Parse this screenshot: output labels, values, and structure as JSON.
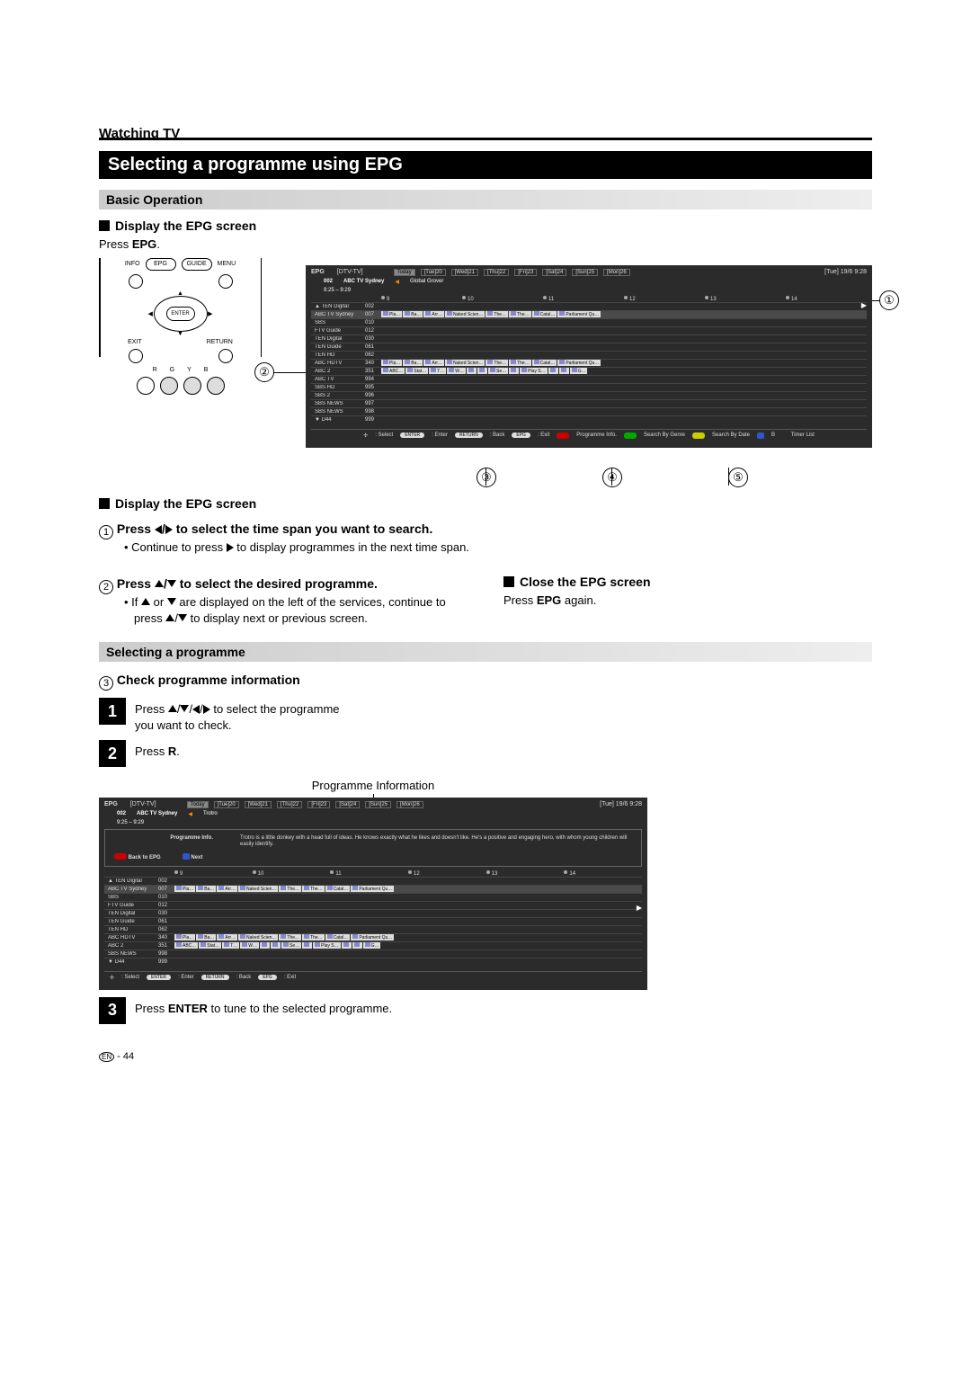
{
  "header": {
    "section": "Watching TV"
  },
  "title": "Selecting a programme using EPG",
  "basic": {
    "label": "Basic Operation",
    "display_heading": "Display the EPG screen",
    "press_epg": "Press ",
    "press_epg_bold": "EPG",
    "dot": "."
  },
  "remote": {
    "info": "INFO",
    "epg": "EPG",
    "guide": "GUIDE",
    "menu": "MENU",
    "enter": "ENTER",
    "exit": "EXIT",
    "return": "RETURN",
    "r": "R",
    "g": "G",
    "y": "Y",
    "b": "B"
  },
  "epg": {
    "title": "EPG",
    "mode": "[DTV-TV]",
    "days": [
      "Today",
      "[Tue]20",
      "[Wed]21",
      "[Thu]22",
      "[Fri]23",
      "[Sat]24",
      "[Sun]25",
      "[Mon]26"
    ],
    "datetime": "[Tue] 19/6 9:28",
    "current_num": "002",
    "current_ch": "ABC TV Sydney",
    "current_prog": "Global Grover",
    "current_time": "9:25 – 9:29",
    "times": [
      "9",
      "10",
      "11",
      "12",
      "13",
      "14"
    ],
    "channels": [
      {
        "name": "TEN Digital",
        "num": "002",
        "progs": [],
        "up": true
      },
      {
        "name": "ABC TV Sydney",
        "num": "007",
        "progs": [
          "Pla…",
          "Ba…",
          "Arr…",
          "Naked Scien…",
          "The…",
          "The…",
          "Catal…",
          "Parliament Qu…"
        ],
        "sel": true
      },
      {
        "name": "SBS",
        "num": "010",
        "progs": []
      },
      {
        "name": "FTV Guide",
        "num": "012",
        "progs": []
      },
      {
        "name": "TEN Digital",
        "num": "030",
        "progs": []
      },
      {
        "name": "TEN Guide",
        "num": "061",
        "progs": []
      },
      {
        "name": "TEN HD",
        "num": "062",
        "progs": []
      },
      {
        "name": "ABC HDTV",
        "num": "340",
        "progs": [
          "Pla…",
          "Ba…",
          "Arr…",
          "Naked Scien…",
          "The…",
          "The…",
          "Catal…",
          "Parliament Qu…"
        ]
      },
      {
        "name": "ABC 2",
        "num": "351",
        "progs": [
          "ABC…",
          "Stat…",
          "T…",
          "W…",
          "",
          "",
          "Se…",
          "",
          "Play S…",
          "",
          "",
          "G…"
        ]
      },
      {
        "name": "ABC TV",
        "num": "994",
        "progs": []
      },
      {
        "name": "SBS HD",
        "num": "995",
        "progs": []
      },
      {
        "name": "SBS 2",
        "num": "996",
        "progs": []
      },
      {
        "name": "SBS NEWS",
        "num": "997",
        "progs": []
      },
      {
        "name": "SBS NEWS",
        "num": "998",
        "progs": []
      },
      {
        "name": "D44",
        "num": "999",
        "progs": [],
        "down": true
      }
    ],
    "footer": {
      "select": ": Select",
      "enter": ": Enter",
      "back": ": Back",
      "exit": ": Exit",
      "r": "Programme Info.",
      "g": "Search By Genre",
      "y": "Search By Date",
      "b": "B",
      "timer": "Timer List",
      "enter_pill": "ENTER",
      "return_pill": "RETURN",
      "epg_pill": "EPG"
    }
  },
  "below": {
    "display_heading": "Display the EPG screen",
    "step1": " Press ◀/▶ to select the time span you want to search.",
    "step1_note": "Continue to press ▶ to display programmes in the next time span.",
    "step2": " Press ▲/▼ to select the desired programme.",
    "step2_note": "If ▲ or ▼ are displayed on the left of the services, continue to press ▲/▼ to display next or previous screen.",
    "close_heading": "Close the EPG screen",
    "close_text_a": "Press ",
    "close_text_b": "EPG",
    "close_text_c": " again."
  },
  "selecting": {
    "bar": "Selecting a programme",
    "check": " Check programme information",
    "row1a": "Press ▲/▼/◀/▶ to select the programme you want to check.",
    "row2a": "Press ",
    "row2b": "R",
    "row2c": ".",
    "caption": "Programme Information",
    "row3a": "Press ",
    "row3b": "ENTER",
    "row3c": " to tune to the selected programme."
  },
  "epg2": {
    "current_prog": "Trotro",
    "info_label": "Programme Info.",
    "desc": "Trotro is a little donkey with a head full of ideas. He knows exactly what he likes and doesn't like. He's a positive and engaging hero, with whom young children will easily identify.",
    "back": "Back to EPG",
    "next": "Next",
    "channels": [
      {
        "name": "TEN Digital",
        "num": "002",
        "progs": [],
        "up": true
      },
      {
        "name": "ABC TV Sydney",
        "num": "007",
        "progs": [
          "Pla…",
          "Ba…",
          "Arr…",
          "Naked Scien…",
          "The…",
          "The…",
          "Catal…",
          "Parliament Qu…"
        ],
        "sel": true
      },
      {
        "name": "SBS",
        "num": "010",
        "progs": []
      },
      {
        "name": "FTV Guide",
        "num": "012",
        "progs": []
      },
      {
        "name": "TEN Digital",
        "num": "030",
        "progs": []
      },
      {
        "name": "TEN Guide",
        "num": "061",
        "progs": []
      },
      {
        "name": "TEN HD",
        "num": "062",
        "progs": []
      },
      {
        "name": "ABC HDTV",
        "num": "340",
        "progs": [
          "Pla…",
          "Ba…",
          "Arr…",
          "Naked Scien…",
          "The…",
          "The…",
          "Catal…",
          "Parliament Qu…"
        ]
      },
      {
        "name": "ABC 2",
        "num": "351",
        "progs": [
          "ABC…",
          "Stat…",
          "T…",
          "W…",
          "",
          "",
          "Se…",
          "",
          "Play S…",
          "",
          "",
          "G…"
        ]
      },
      {
        "name": "SBS NEWS",
        "num": "998",
        "progs": []
      },
      {
        "name": "D44",
        "num": "999",
        "progs": [],
        "down": true
      }
    ]
  },
  "page": "44",
  "page_en": "EN"
}
